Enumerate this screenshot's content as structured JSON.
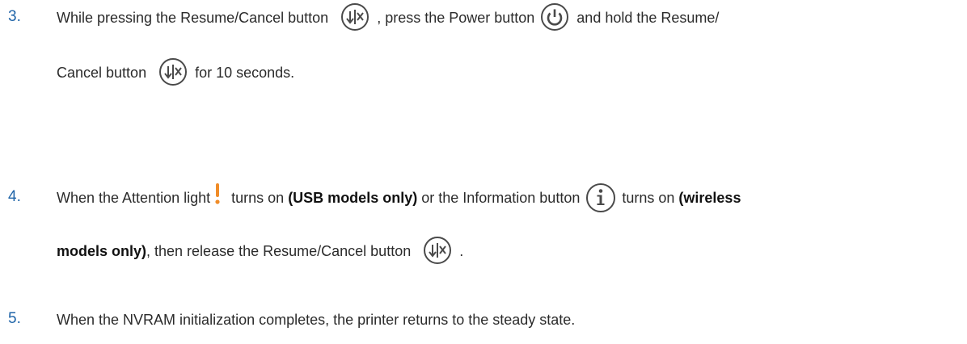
{
  "steps": [
    {
      "number": "3.",
      "line1": {
        "t1": "While pressing the Resume/Cancel button",
        "t2": ", press the Power button",
        "t3": "and hold the Resume/"
      },
      "line2": {
        "t1": "Cancel button",
        "t2": "for 10 seconds."
      }
    },
    {
      "number": "4.",
      "line1": {
        "t1": "When the Attention light",
        "t2": "turns on",
        "b1": "(USB models only)",
        "t3": "or the Information button",
        "t4": "turns on",
        "b2": "(wireless"
      },
      "line2": {
        "b1": "models only)",
        "t1": ", then release the Resume/Cancel button",
        "t2": "."
      }
    },
    {
      "number": "5.",
      "line1": {
        "t1": "When the NVRAM initialization completes, the printer returns to the steady state."
      }
    }
  ],
  "icons": {
    "resume_cancel": "resume-cancel-icon",
    "power": "power-icon",
    "attention": "attention-icon",
    "information": "information-icon"
  },
  "colors": {
    "step_number": "#1f64a8",
    "attention": "#f08c28",
    "icon_stroke": "#4a4a4a"
  }
}
